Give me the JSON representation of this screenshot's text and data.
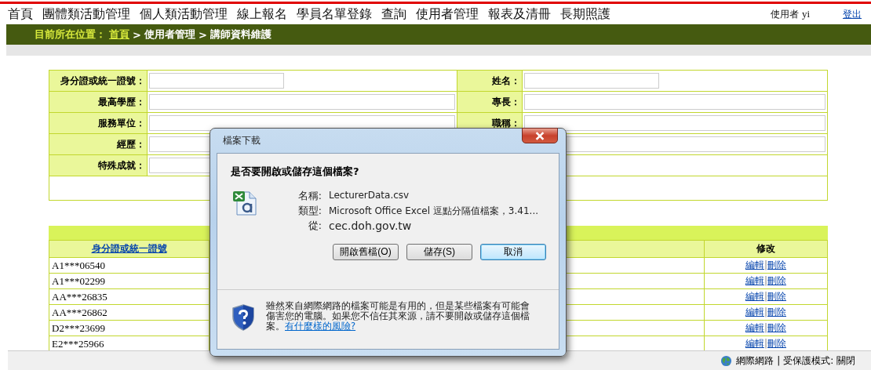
{
  "nav": {
    "items": [
      "首頁",
      "團體類活動管理",
      "個人類活動管理",
      "線上報名",
      "學員名單登錄",
      "查詢",
      "使用者管理",
      "報表及清冊",
      "長期照護"
    ],
    "user_label": "使用者",
    "user_name": "yi",
    "logout": "登出"
  },
  "breadcrumb": {
    "label": "目前所在位置：",
    "items": [
      {
        "text": "首頁",
        "kind": "link"
      },
      {
        "separator": ">",
        "text": "使用者管理",
        "kind": "text"
      },
      {
        "separator": ">",
        "text": "講師資料維護",
        "kind": "text"
      }
    ]
  },
  "form": {
    "rows": [
      {
        "cells": [
          {
            "label": "身分證或統一證號：",
            "kind": "short"
          },
          {
            "label": "姓名：",
            "kind": "short"
          }
        ]
      },
      {
        "cells": [
          {
            "label": "最高學歷：",
            "kind": "full"
          },
          {
            "label": "專長：",
            "kind": "full"
          }
        ]
      },
      {
        "cells": [
          {
            "label": "服務單位：",
            "kind": "full"
          },
          {
            "label": "職稱：",
            "kind": "full"
          }
        ]
      },
      {
        "cells": [
          {
            "label": "經歷：",
            "kind": "full"
          },
          {
            "kind": "full"
          }
        ]
      },
      {
        "cells": [
          {
            "label": "特殊成就：",
            "kind": "full"
          },
          {
            "kind": "empty"
          }
        ]
      }
    ]
  },
  "results": {
    "columns": [
      {
        "label": "身分證或統一證號",
        "kind": "link"
      },
      {
        "label": "修改",
        "kind": "text"
      }
    ],
    "rows": [
      {
        "id": "A1***06540",
        "edit": "編輯",
        "sep": "|",
        "delete": "刪除"
      },
      {
        "id": "A1***02299",
        "edit": "編輯",
        "sep": "|",
        "delete": "刪除"
      },
      {
        "id": "AA***26835",
        "edit": "編輯",
        "sep": "|",
        "delete": "刪除"
      },
      {
        "id": "AA***26862",
        "edit": "編輯",
        "sep": "|",
        "delete": "刪除"
      },
      {
        "id": "D2***23699",
        "edit": "編輯",
        "sep": "|",
        "delete": "刪除"
      },
      {
        "id": "E2***25966",
        "edit": "編輯",
        "sep": "|",
        "delete": "刪除"
      }
    ]
  },
  "dialog": {
    "title": "檔案下載",
    "question": "是否要開啟或儲存這個檔案?",
    "info": [
      {
        "label": "名稱:",
        "value": "LecturerData.csv"
      },
      {
        "label": "類型:",
        "value": "Microsoft Office Excel 逗點分隔值檔案，3.41..."
      },
      {
        "label": "從:",
        "value": "cec.doh.gov.tw"
      }
    ],
    "buttons": [
      {
        "label": "開啟舊檔(O)",
        "default": false
      },
      {
        "label": "儲存(S)",
        "default": false
      },
      {
        "label": "取消",
        "default": true
      }
    ],
    "warning": "雖然來自網際網路的檔案可能是有用的，但是某些檔案有可能會傷害您的電腦。如果您不信任其來源，請不要開啟或儲存這個檔案。",
    "risk_link": "有什麼樣的風險?"
  },
  "status_bar": {
    "zone": "網際網路 | 受保護模式: 關閉"
  }
}
